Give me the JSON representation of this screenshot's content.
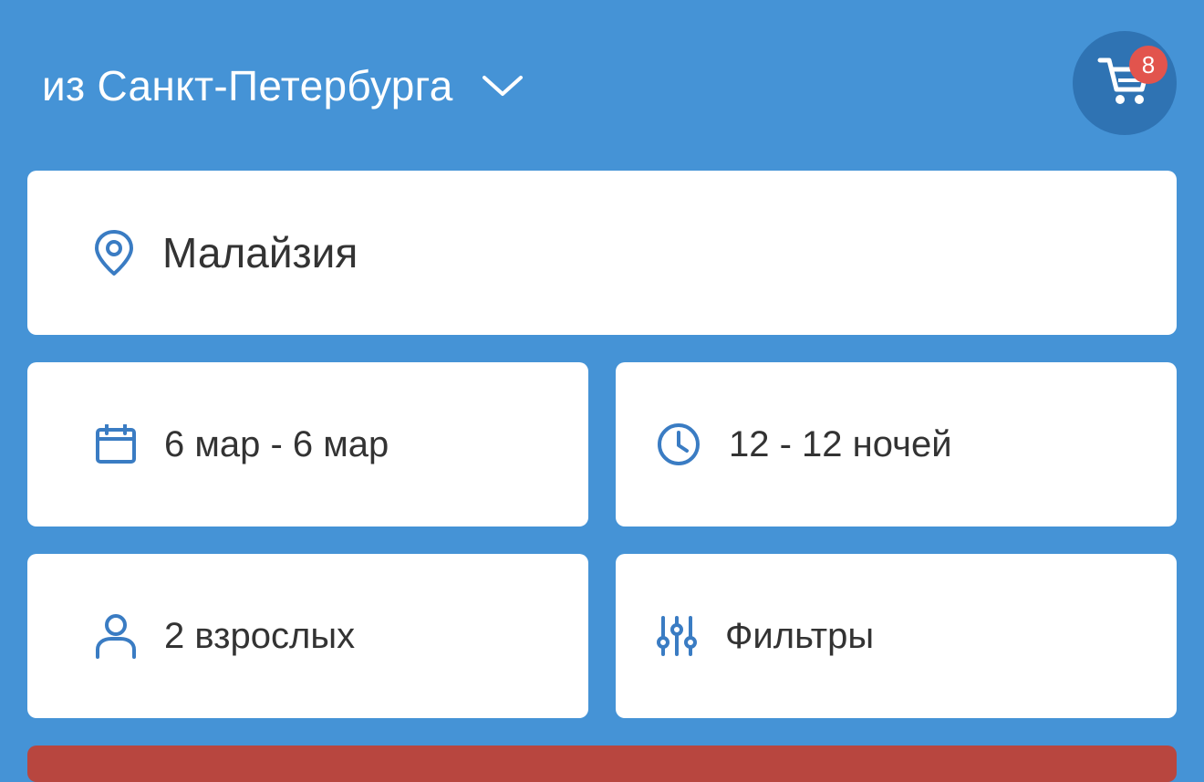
{
  "header": {
    "departure_city": "из Санкт-Петербурга",
    "cart_count": "8"
  },
  "search": {
    "destination": "Малайзия",
    "dates": "6 мар - 6 мар",
    "nights": "12 - 12 ночей",
    "travelers": "2 взрослых",
    "filters_label": "Фильтры"
  },
  "colors": {
    "background": "#4593d6",
    "icon_accent": "#3a7cc3",
    "cart_button": "#2f73b3",
    "badge": "#e2544d",
    "search_button": "#b8463f"
  }
}
